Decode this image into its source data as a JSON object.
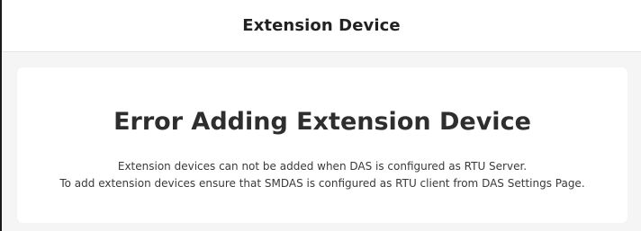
{
  "header": {
    "title": "Extension Device"
  },
  "error": {
    "title": "Error Adding Extension Device",
    "line1": "Extension devices can not be added when DAS is configured as RTU Server.",
    "line2": "To add extension devices ensure that SMDAS is configured as RTU client from DAS Settings Page."
  },
  "colors": {
    "background": "#f5f5f5",
    "card": "#ffffff",
    "title_text": "#2e2e2e",
    "body_text": "#3a3a3a"
  }
}
